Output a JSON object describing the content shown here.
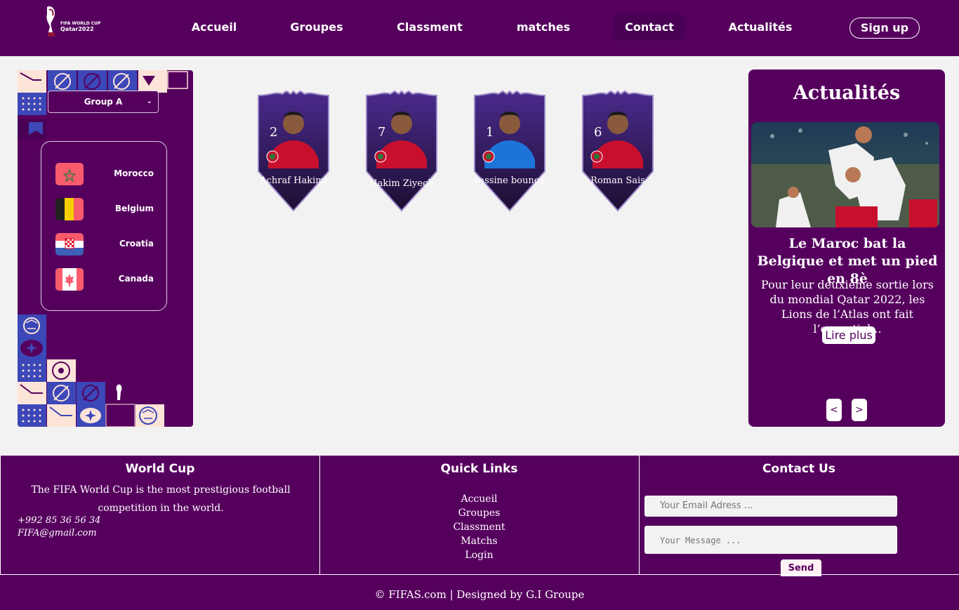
{
  "nav": {
    "logo_text": [
      "FIFA WORLD CUP",
      "Qatar2022"
    ],
    "items": [
      "Accueil",
      "Groupes",
      "Classment",
      "matches",
      "Contact",
      "Actualités"
    ],
    "active": "Contact",
    "signup": "Sign up"
  },
  "group_select": {
    "value": "Group A"
  },
  "teams": [
    "Morocco",
    "Belgium",
    "Croatia",
    "Canada"
  ],
  "players": [
    {
      "number": "2",
      "name": "Achraf Hakimi",
      "shirt_color": "#c8102e"
    },
    {
      "number": "7",
      "name": "Hakim Ziyech",
      "shirt_color": "#c8102e"
    },
    {
      "number": "1",
      "name": "yassine bounou",
      "shirt_color": "#1e73d8"
    },
    {
      "number": "6",
      "name": "Roman Sais",
      "shirt_color": "#c8102e"
    }
  ],
  "news": {
    "heading": "Actualités",
    "title": "Le Maroc bat la Belgique et met un pied en 8è",
    "excerpt": "Pour leur deuxième sortie lors du mondial Qatar 2022, les Lions de l’Atlas ont fait l’essentiel...",
    "read_more": "Lire plus",
    "prev": "<",
    "next": ">"
  },
  "footer": {
    "worldcup": {
      "title": "World Cup",
      "description": "The FIFA World Cup is the most prestigious football competition in the world.",
      "phone": "+992 85 36 56 34",
      "email": "FIFA@gmail.com"
    },
    "quicklinks": {
      "title": "Quick Links",
      "links": [
        "Accueil",
        "Groupes",
        "Classment",
        "Matchs",
        "Login"
      ]
    },
    "contact": {
      "title": "Contact Us",
      "email_placeholder": "Your Email Adress ...",
      "message_placeholder": "Your Message ...",
      "send": "Send"
    },
    "copyright": "© FIFAS.com | Designed by G.I Groupe"
  },
  "colors": {
    "brand": "#56005e",
    "accent": "#3c47b8"
  }
}
